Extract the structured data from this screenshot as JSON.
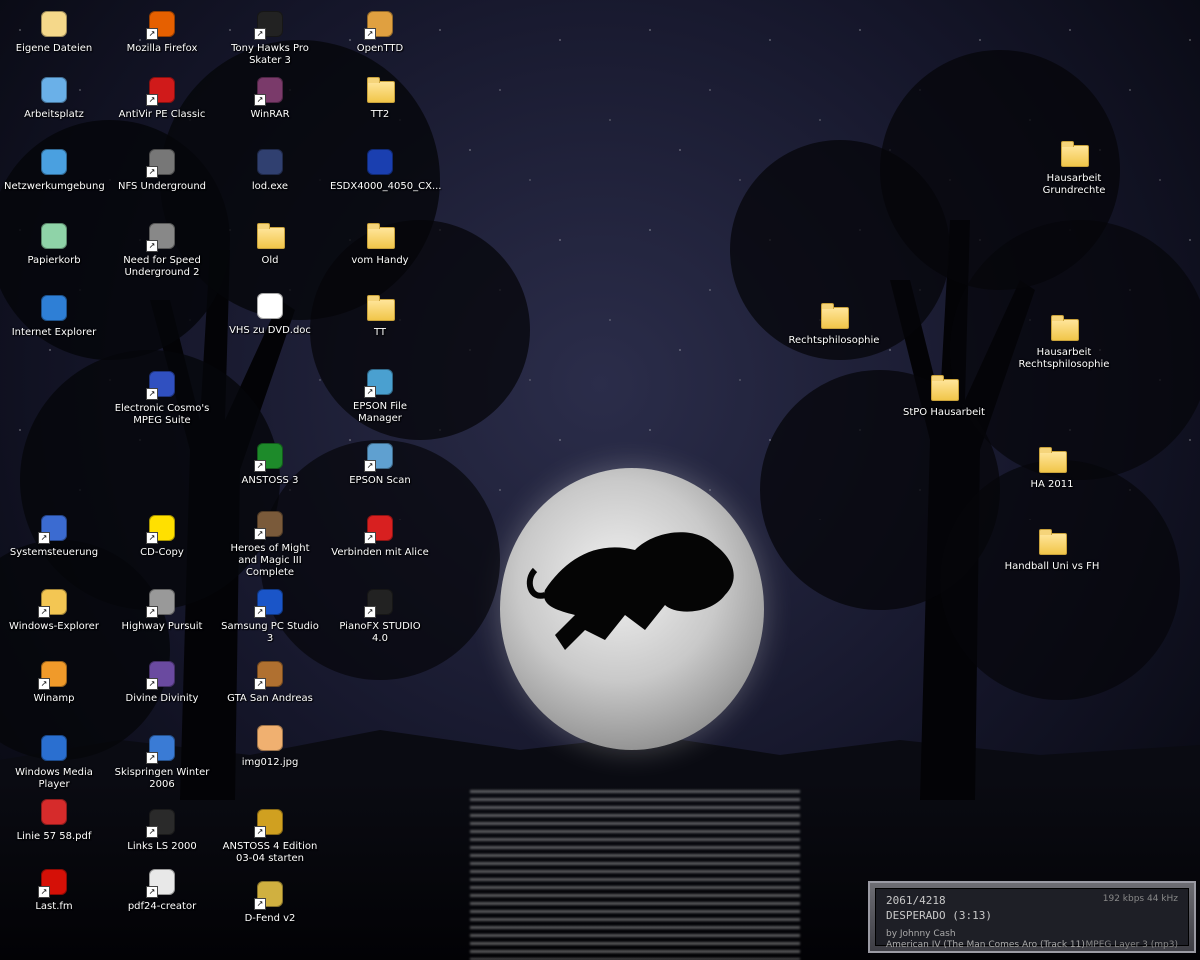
{
  "desktop": {
    "icons": [
      {
        "label": "Eigene Dateien",
        "icon": "my-documents-icon",
        "shortcut": false
      },
      {
        "label": "Arbeitsplatz",
        "icon": "my-computer-icon",
        "shortcut": false
      },
      {
        "label": "Netzwerkumgebung",
        "icon": "network-icon",
        "shortcut": false
      },
      {
        "label": "Papierkorb",
        "icon": "recycle-bin-icon",
        "shortcut": false
      },
      {
        "label": "Internet Explorer",
        "icon": "ie-icon",
        "shortcut": false
      },
      {
        "label": "Systemsteuerung",
        "icon": "control-panel-icon",
        "shortcut": true
      },
      {
        "label": "Windows-Explorer",
        "icon": "explorer-icon",
        "shortcut": true
      },
      {
        "label": "Winamp",
        "icon": "winamp-icon",
        "shortcut": true
      },
      {
        "label": "Windows Media Player",
        "icon": "media-player-icon",
        "shortcut": false
      },
      {
        "label": "Linie 57 58.pdf",
        "icon": "pdf-icon",
        "shortcut": false
      },
      {
        "label": "Last.fm",
        "icon": "lastfm-icon",
        "shortcut": true
      },
      {
        "label": "Mozilla Firefox",
        "icon": "firefox-icon",
        "shortcut": true
      },
      {
        "label": "AntiVir PE Classic",
        "icon": "antivir-icon",
        "shortcut": true
      },
      {
        "label": "NFS Underground",
        "icon": "nfs-icon",
        "shortcut": true
      },
      {
        "label": "Need for Speed Underground 2",
        "icon": "nfs2-icon",
        "shortcut": true
      },
      {
        "label": "Electronic Cosmo's MPEG Suite",
        "icon": "mpeg-suite-icon",
        "shortcut": true
      },
      {
        "label": "CD-Copy",
        "icon": "smiley-icon",
        "shortcut": true
      },
      {
        "label": "Highway Pursuit",
        "icon": "highway-icon",
        "shortcut": true
      },
      {
        "label": "Divine Divinity",
        "icon": "divinity-icon",
        "shortcut": true
      },
      {
        "label": "Skispringen Winter 2006",
        "icon": "ski-icon",
        "shortcut": true
      },
      {
        "label": "Links LS 2000",
        "icon": "links-icon",
        "shortcut": true
      },
      {
        "label": "pdf24-creator",
        "icon": "pdf24-icon",
        "shortcut": true
      },
      {
        "label": "Tony Hawks Pro Skater 3",
        "icon": "thps3-icon",
        "shortcut": true
      },
      {
        "label": "WinRAR",
        "icon": "winrar-icon",
        "shortcut": true
      },
      {
        "label": "lod.exe",
        "icon": "lod-icon",
        "shortcut": false
      },
      {
        "label": "Old",
        "icon": "folder-icon",
        "shortcut": false
      },
      {
        "label": "VHS zu DVD.doc",
        "icon": "word-doc-icon",
        "shortcut": false
      },
      {
        "label": "ANSTOSS 3",
        "icon": "anstoss3-icon",
        "shortcut": true
      },
      {
        "label": "Heroes of Might and Magic III Complete",
        "icon": "homm3-icon",
        "shortcut": true
      },
      {
        "label": "Samsung PC Studio 3",
        "icon": "samsung-icon",
        "shortcut": true
      },
      {
        "label": "GTA San Andreas",
        "icon": "gta-icon",
        "shortcut": true
      },
      {
        "label": "img012.jpg",
        "icon": "image-icon",
        "shortcut": false
      },
      {
        "label": "ANSTOSS 4 Edition 03-04 starten",
        "icon": "anstoss4-icon",
        "shortcut": true
      },
      {
        "label": "D-Fend v2",
        "icon": "dfend-icon",
        "shortcut": true
      },
      {
        "label": "OpenTTD",
        "icon": "openttd-icon",
        "shortcut": true
      },
      {
        "label": "TT2",
        "icon": "folder-icon",
        "shortcut": false
      },
      {
        "label": "ESDX4000_4050_CX...",
        "icon": "epson-icon",
        "shortcut": false
      },
      {
        "label": "vom Handy",
        "icon": "folder-icon",
        "shortcut": false
      },
      {
        "label": "TT",
        "icon": "folder-icon",
        "shortcut": false
      },
      {
        "label": "EPSON File Manager",
        "icon": "epson-file-manager-icon",
        "shortcut": true
      },
      {
        "label": "EPSON Scan",
        "icon": "epson-scan-icon",
        "shortcut": true
      },
      {
        "label": "Verbinden mit Alice",
        "icon": "alice-icon",
        "shortcut": true
      },
      {
        "label": "PianoFX STUDIO 4.0",
        "icon": "pianofx-icon",
        "shortcut": true
      },
      {
        "label": "Rechtsphilosophie",
        "icon": "folder-icon",
        "shortcut": false
      },
      {
        "label": "StPO Hausarbeit",
        "icon": "folder-icon",
        "shortcut": false
      },
      {
        "label": "Hausarbeit Grundrechte",
        "icon": "folder-icon",
        "shortcut": false
      },
      {
        "label": "Hausarbeit Rechtsphilosophie",
        "icon": "folder-icon",
        "shortcut": false
      },
      {
        "label": "HA 2011",
        "icon": "folder-icon",
        "shortcut": false
      },
      {
        "label": "Handball Uni vs FH",
        "icon": "folder-icon",
        "shortcut": false
      }
    ]
  },
  "winamp": {
    "counter": "2061/4218",
    "title": "DESPERADO (3:13)",
    "artist": "by Johnny Cash",
    "album": "American IV (The Man Comes Aro (Track 11)",
    "bitrate": "192 kbps 44 kHz",
    "format": "MPEG Layer 3 (mp3)"
  }
}
